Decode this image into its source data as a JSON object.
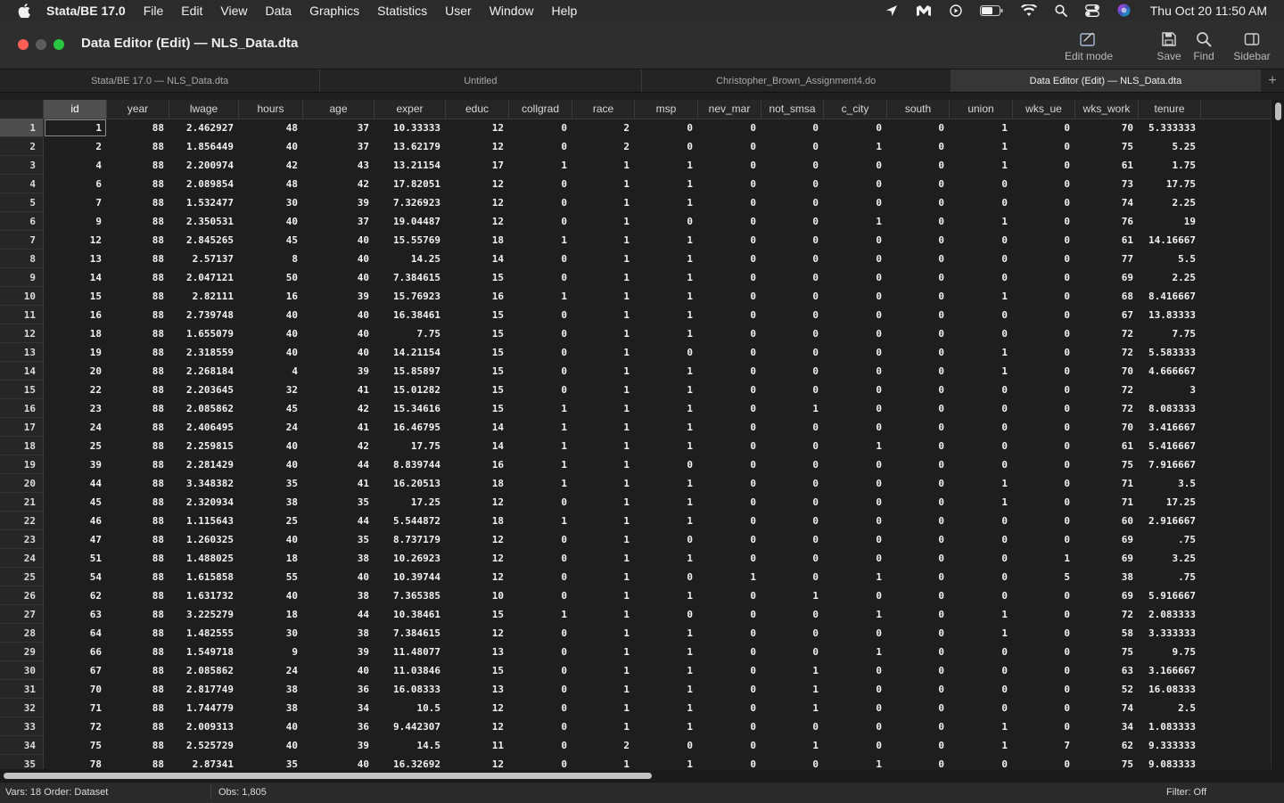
{
  "menubar": {
    "items": [
      "Stata/BE 17.0",
      "File",
      "Edit",
      "View",
      "Data",
      "Graphics",
      "Statistics",
      "User",
      "Window",
      "Help"
    ],
    "clock": "Thu Oct 20  11:50 AM",
    "status_icons": [
      "location-arrow-icon",
      "malwarebytes-icon",
      "play-circle-icon",
      "battery-icon",
      "wifi-icon",
      "search-icon",
      "control-center-icon",
      "siri-icon"
    ]
  },
  "window": {
    "title": "Data Editor (Edit) — NLS_Data.dta",
    "toolbar": {
      "edit_mode": "Edit mode",
      "save": "Save",
      "find": "Find",
      "sidebar": "Sidebar"
    }
  },
  "tabs": [
    {
      "label": "Stata/BE 17.0 — NLS_Data.dta",
      "active": false
    },
    {
      "label": "Untitled",
      "active": false
    },
    {
      "label": "Christopher_Brown_Assignment4.do",
      "active": false
    },
    {
      "label": "Data Editor (Edit) — NLS_Data.dta",
      "active": true
    }
  ],
  "grid": {
    "columns": [
      "id",
      "year",
      "lwage",
      "hours",
      "age",
      "exper",
      "educ",
      "collgrad",
      "race",
      "msp",
      "nev_mar",
      "not_smsa",
      "c_city",
      "south",
      "union",
      "wks_ue",
      "wks_work",
      "tenure"
    ],
    "rows": [
      [
        "1",
        "88",
        "2.462927",
        "48",
        "37",
        "10.33333",
        "12",
        "0",
        "2",
        "0",
        "0",
        "0",
        "0",
        "0",
        "1",
        "0",
        "70",
        "5.333333"
      ],
      [
        "2",
        "88",
        "1.856449",
        "40",
        "37",
        "13.62179",
        "12",
        "0",
        "2",
        "0",
        "0",
        "0",
        "1",
        "0",
        "1",
        "0",
        "75",
        "5.25"
      ],
      [
        "4",
        "88",
        "2.200974",
        "42",
        "43",
        "13.21154",
        "17",
        "1",
        "1",
        "1",
        "0",
        "0",
        "0",
        "0",
        "1",
        "0",
        "61",
        "1.75"
      ],
      [
        "6",
        "88",
        "2.089854",
        "48",
        "42",
        "17.82051",
        "12",
        "0",
        "1",
        "1",
        "0",
        "0",
        "0",
        "0",
        "0",
        "0",
        "73",
        "17.75"
      ],
      [
        "7",
        "88",
        "1.532477",
        "30",
        "39",
        "7.326923",
        "12",
        "0",
        "1",
        "1",
        "0",
        "0",
        "0",
        "0",
        "0",
        "0",
        "74",
        "2.25"
      ],
      [
        "9",
        "88",
        "2.350531",
        "40",
        "37",
        "19.04487",
        "12",
        "0",
        "1",
        "0",
        "0",
        "0",
        "1",
        "0",
        "1",
        "0",
        "76",
        "19"
      ],
      [
        "12",
        "88",
        "2.845265",
        "45",
        "40",
        "15.55769",
        "18",
        "1",
        "1",
        "1",
        "0",
        "0",
        "0",
        "0",
        "0",
        "0",
        "61",
        "14.16667"
      ],
      [
        "13",
        "88",
        "2.57137",
        "8",
        "40",
        "14.25",
        "14",
        "0",
        "1",
        "1",
        "0",
        "0",
        "0",
        "0",
        "0",
        "0",
        "77",
        "5.5"
      ],
      [
        "14",
        "88",
        "2.047121",
        "50",
        "40",
        "7.384615",
        "15",
        "0",
        "1",
        "1",
        "0",
        "0",
        "0",
        "0",
        "0",
        "0",
        "69",
        "2.25"
      ],
      [
        "15",
        "88",
        "2.82111",
        "16",
        "39",
        "15.76923",
        "16",
        "1",
        "1",
        "1",
        "0",
        "0",
        "0",
        "0",
        "1",
        "0",
        "68",
        "8.416667"
      ],
      [
        "16",
        "88",
        "2.739748",
        "40",
        "40",
        "16.38461",
        "15",
        "0",
        "1",
        "1",
        "0",
        "0",
        "0",
        "0",
        "0",
        "0",
        "67",
        "13.83333"
      ],
      [
        "18",
        "88",
        "1.655079",
        "40",
        "40",
        "7.75",
        "15",
        "0",
        "1",
        "1",
        "0",
        "0",
        "0",
        "0",
        "0",
        "0",
        "72",
        "7.75"
      ],
      [
        "19",
        "88",
        "2.318559",
        "40",
        "40",
        "14.21154",
        "15",
        "0",
        "1",
        "0",
        "0",
        "0",
        "0",
        "0",
        "1",
        "0",
        "72",
        "5.583333"
      ],
      [
        "20",
        "88",
        "2.268184",
        "4",
        "39",
        "15.85897",
        "15",
        "0",
        "1",
        "1",
        "0",
        "0",
        "0",
        "0",
        "1",
        "0",
        "70",
        "4.666667"
      ],
      [
        "22",
        "88",
        "2.203645",
        "32",
        "41",
        "15.01282",
        "15",
        "0",
        "1",
        "1",
        "0",
        "0",
        "0",
        "0",
        "0",
        "0",
        "72",
        "3"
      ],
      [
        "23",
        "88",
        "2.085862",
        "45",
        "42",
        "15.34616",
        "15",
        "1",
        "1",
        "1",
        "0",
        "1",
        "0",
        "0",
        "0",
        "0",
        "72",
        "8.083333"
      ],
      [
        "24",
        "88",
        "2.406495",
        "24",
        "41",
        "16.46795",
        "14",
        "1",
        "1",
        "1",
        "0",
        "0",
        "0",
        "0",
        "0",
        "0",
        "70",
        "3.416667"
      ],
      [
        "25",
        "88",
        "2.259815",
        "40",
        "42",
        "17.75",
        "14",
        "1",
        "1",
        "1",
        "0",
        "0",
        "1",
        "0",
        "0",
        "0",
        "61",
        "5.416667"
      ],
      [
        "39",
        "88",
        "2.281429",
        "40",
        "44",
        "8.839744",
        "16",
        "1",
        "1",
        "0",
        "0",
        "0",
        "0",
        "0",
        "0",
        "0",
        "75",
        "7.916667"
      ],
      [
        "44",
        "88",
        "3.348382",
        "35",
        "41",
        "16.20513",
        "18",
        "1",
        "1",
        "1",
        "0",
        "0",
        "0",
        "0",
        "1",
        "0",
        "71",
        "3.5"
      ],
      [
        "45",
        "88",
        "2.320934",
        "38",
        "35",
        "17.25",
        "12",
        "0",
        "1",
        "1",
        "0",
        "0",
        "0",
        "0",
        "1",
        "0",
        "71",
        "17.25"
      ],
      [
        "46",
        "88",
        "1.115643",
        "25",
        "44",
        "5.544872",
        "18",
        "1",
        "1",
        "1",
        "0",
        "0",
        "0",
        "0",
        "0",
        "0",
        "60",
        "2.916667"
      ],
      [
        "47",
        "88",
        "1.260325",
        "40",
        "35",
        "8.737179",
        "12",
        "0",
        "1",
        "0",
        "0",
        "0",
        "0",
        "0",
        "0",
        "0",
        "69",
        ".75"
      ],
      [
        "51",
        "88",
        "1.488025",
        "18",
        "38",
        "10.26923",
        "12",
        "0",
        "1",
        "1",
        "0",
        "0",
        "0",
        "0",
        "0",
        "1",
        "69",
        "3.25"
      ],
      [
        "54",
        "88",
        "1.615858",
        "55",
        "40",
        "10.39744",
        "12",
        "0",
        "1",
        "0",
        "1",
        "0",
        "1",
        "0",
        "0",
        "5",
        "38",
        ".75"
      ],
      [
        "62",
        "88",
        "1.631732",
        "40",
        "38",
        "7.365385",
        "10",
        "0",
        "1",
        "1",
        "0",
        "1",
        "0",
        "0",
        "0",
        "0",
        "69",
        "5.916667"
      ],
      [
        "63",
        "88",
        "3.225279",
        "18",
        "44",
        "10.38461",
        "15",
        "1",
        "1",
        "0",
        "0",
        "0",
        "1",
        "0",
        "1",
        "0",
        "72",
        "2.083333"
      ],
      [
        "64",
        "88",
        "1.482555",
        "30",
        "38",
        "7.384615",
        "12",
        "0",
        "1",
        "1",
        "0",
        "0",
        "0",
        "0",
        "1",
        "0",
        "58",
        "3.333333"
      ],
      [
        "66",
        "88",
        "1.549718",
        "9",
        "39",
        "11.48077",
        "13",
        "0",
        "1",
        "1",
        "0",
        "0",
        "1",
        "0",
        "0",
        "0",
        "75",
        "9.75"
      ],
      [
        "67",
        "88",
        "2.085862",
        "24",
        "40",
        "11.03846",
        "15",
        "0",
        "1",
        "1",
        "0",
        "1",
        "0",
        "0",
        "0",
        "0",
        "63",
        "3.166667"
      ],
      [
        "70",
        "88",
        "2.817749",
        "38",
        "36",
        "16.08333",
        "13",
        "0",
        "1",
        "1",
        "0",
        "1",
        "0",
        "0",
        "0",
        "0",
        "52",
        "16.08333"
      ],
      [
        "71",
        "88",
        "1.744779",
        "38",
        "34",
        "10.5",
        "12",
        "0",
        "1",
        "1",
        "0",
        "1",
        "0",
        "0",
        "0",
        "0",
        "74",
        "2.5"
      ],
      [
        "72",
        "88",
        "2.009313",
        "40",
        "36",
        "9.442307",
        "12",
        "0",
        "1",
        "1",
        "0",
        "0",
        "0",
        "0",
        "1",
        "0",
        "34",
        "1.083333"
      ],
      [
        "75",
        "88",
        "2.525729",
        "40",
        "39",
        "14.5",
        "11",
        "0",
        "2",
        "0",
        "0",
        "1",
        "0",
        "0",
        "1",
        "7",
        "62",
        "9.333333"
      ],
      [
        "78",
        "88",
        "2.87341",
        "35",
        "40",
        "16.32692",
        "12",
        "0",
        "1",
        "1",
        "0",
        "0",
        "1",
        "0",
        "0",
        "0",
        "75",
        "9.083333"
      ]
    ]
  },
  "statusbar": {
    "vars": "Vars: 18  Order: Dataset",
    "obs": "Obs: 1,805",
    "filter": "Filter: Off"
  }
}
